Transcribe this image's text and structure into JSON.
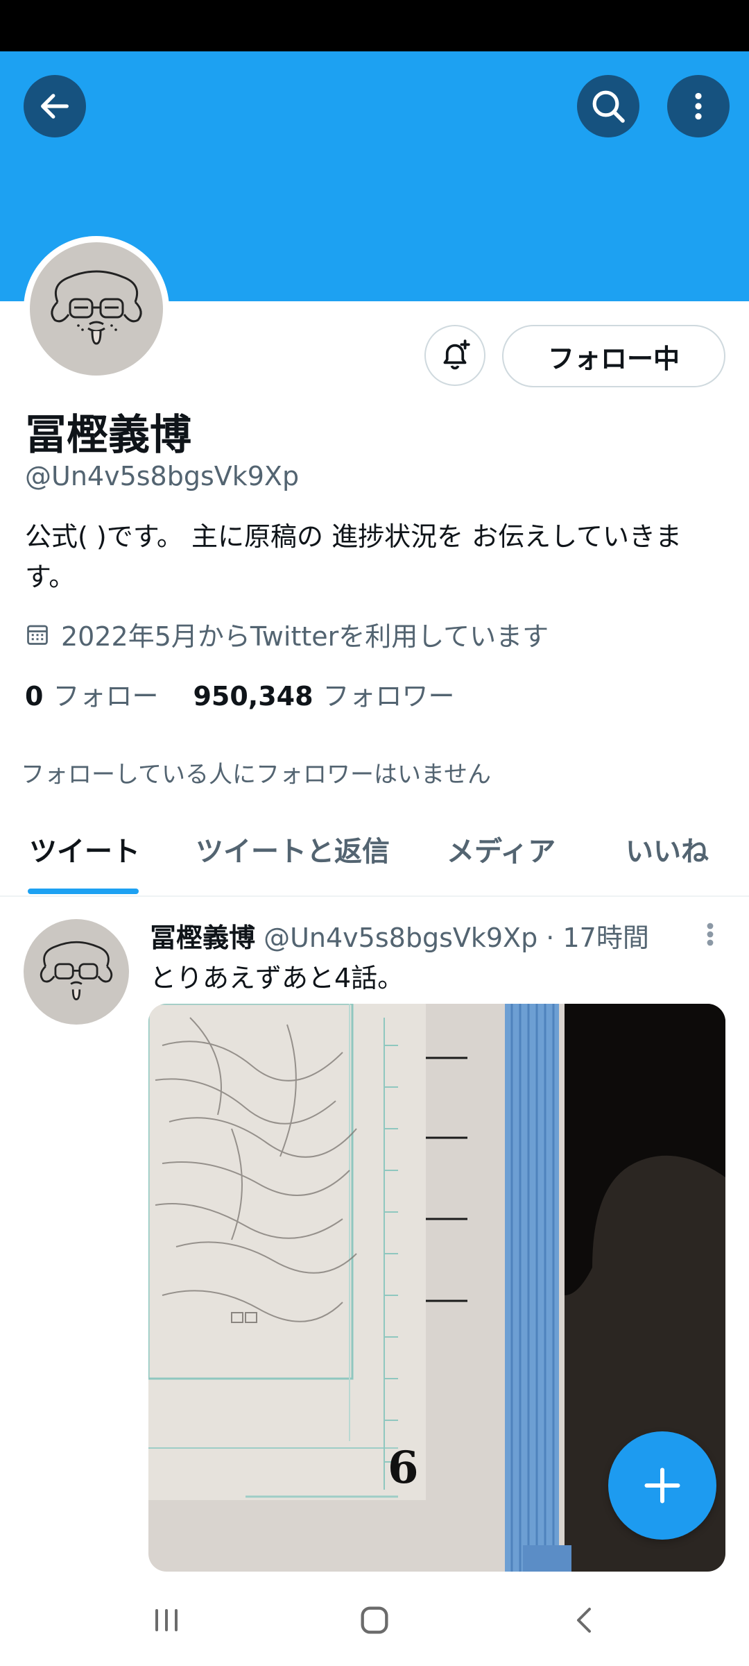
{
  "colors": {
    "banner": "#1da1f2",
    "accent": "#1d9bf0",
    "icon_button_bg": "#16527f",
    "text": "#0f1419",
    "muted": "#536471"
  },
  "header": {
    "icons": [
      "back-arrow-icon",
      "search-icon",
      "more-vert-icon"
    ]
  },
  "profile": {
    "follow_button_label": "フォロー中",
    "name": "冨樫義博",
    "handle": "@Un4v5s8bgsVk9Xp",
    "bio": "公式( )です。 主に原稿の 進捗状況を お伝えしていきます。",
    "joined": "2022年5月からTwitterを利用しています",
    "following_count": "0",
    "following_label": "フォロー",
    "followers_count": "950,348",
    "followers_label": "フォロワー",
    "no_followers_you_know": "フォローしている人にフォロワーはいません"
  },
  "tabs": [
    {
      "label": "ツイート",
      "active": true
    },
    {
      "label": "ツイートと返信",
      "active": false
    },
    {
      "label": "メディア",
      "active": false
    },
    {
      "label": "いいね",
      "active": false
    }
  ],
  "tweet": {
    "name": "冨樫義博",
    "handle": "@Un4v5s8bgsVk9Xp",
    "separator": "·",
    "time": "17時間",
    "text": "とりあえずあと4話。",
    "media_handwritten_number": "6"
  },
  "fab": {
    "icon": "plus-icon"
  },
  "system_nav": {
    "icons": [
      "recent-apps-icon",
      "home-icon",
      "back-icon"
    ]
  }
}
